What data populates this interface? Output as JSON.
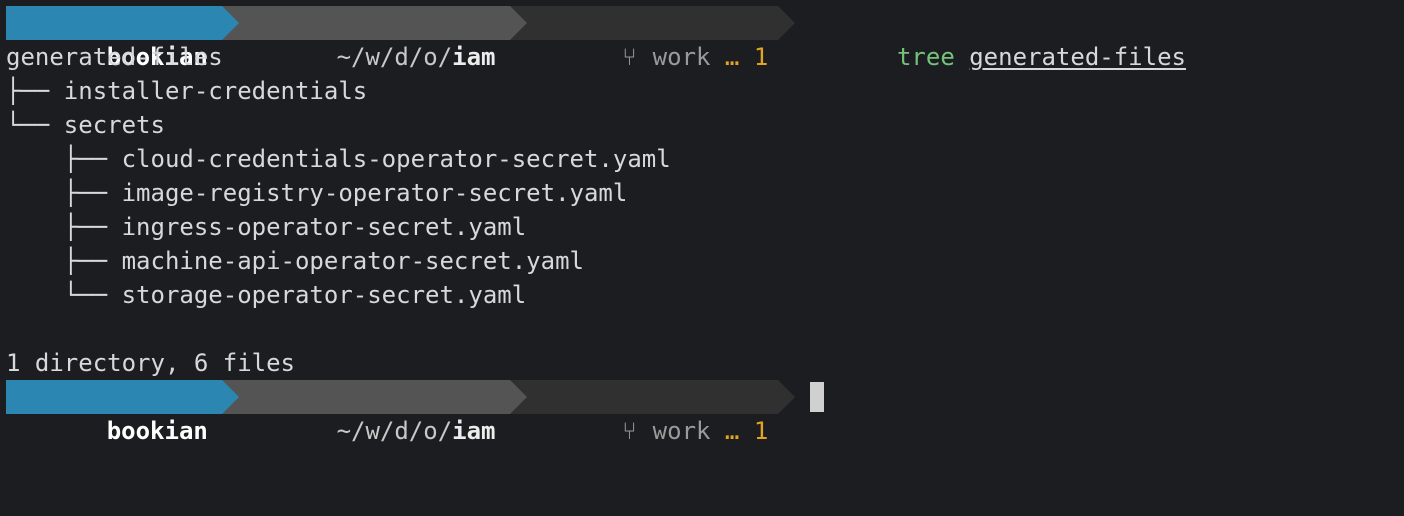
{
  "prompt": {
    "user": "bookian",
    "path_prefix": "~/w/d/o/",
    "path_current": "iam",
    "branch_icon": "git-branch-icon",
    "branch": "work",
    "dirty_marker": "…",
    "dirty_count": "1"
  },
  "command": {
    "binary": "tree",
    "argument": "generated-files"
  },
  "output": {
    "root": "generated-files",
    "lines": [
      "├── installer-credentials",
      "└── secrets",
      "    ├── cloud-credentials-operator-secret.yaml",
      "    ├── image-registry-operator-secret.yaml",
      "    ├── ingress-operator-secret.yaml",
      "    ├── machine-api-operator-secret.yaml",
      "    └── storage-operator-secret.yaml"
    ],
    "summary": "1 directory, 6 files"
  },
  "colors": {
    "background": "#1c1d20",
    "user_segment": "#2b86b1",
    "path_segment": "#545454",
    "git_segment": "#303030",
    "command_green": "#76c27a",
    "dirty_orange": "#e2a424"
  }
}
